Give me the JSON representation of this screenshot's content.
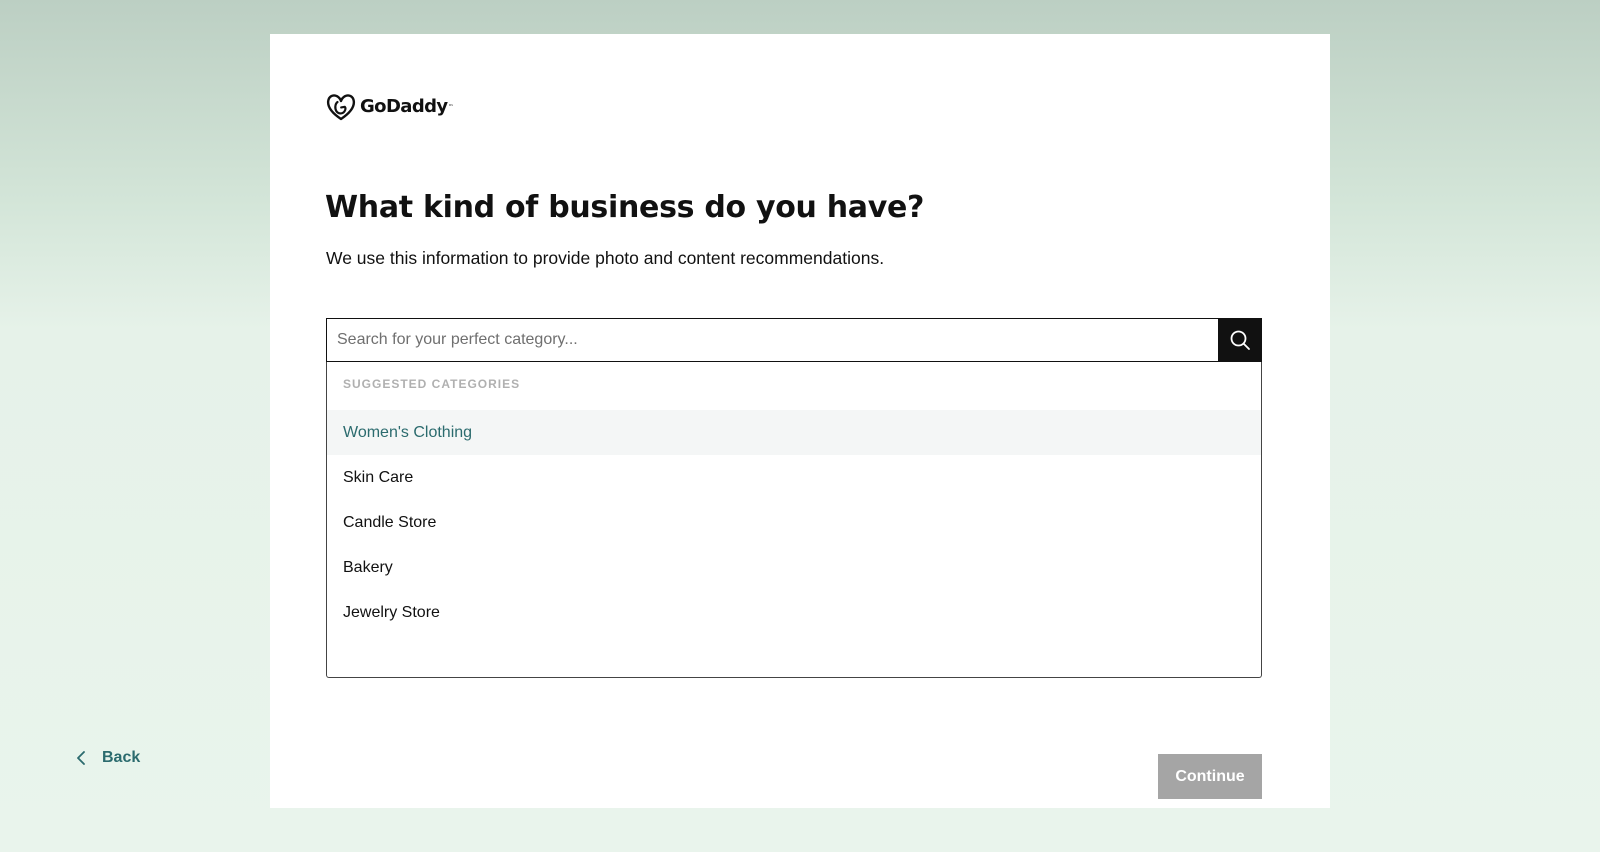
{
  "brand": {
    "logo_text": "GoDaddy",
    "logo_mark": "™"
  },
  "page": {
    "heading": "What kind of business do you have?",
    "subtext": "We use this information to provide photo and content recommendations."
  },
  "search": {
    "placeholder": "Search for your perfect category...",
    "value": "",
    "icon": "search-icon"
  },
  "suggestions": {
    "label": "SUGGESTED CATEGORIES",
    "items": [
      {
        "label": "Women's Clothing",
        "highlighted": true
      },
      {
        "label": "Skin Care",
        "highlighted": false
      },
      {
        "label": "Candle Store",
        "highlighted": false
      },
      {
        "label": "Bakery",
        "highlighted": false
      },
      {
        "label": "Jewelry Store",
        "highlighted": false
      }
    ]
  },
  "footer": {
    "back_label": "Back",
    "back_icon": "chevron-left-icon",
    "continue_label": "Continue",
    "continue_enabled": false
  },
  "colors": {
    "accent": "#2b6b6e",
    "button_disabled": "#a5a5a5",
    "search_button": "#111111",
    "highlight_bg": "#f4f6f6"
  }
}
